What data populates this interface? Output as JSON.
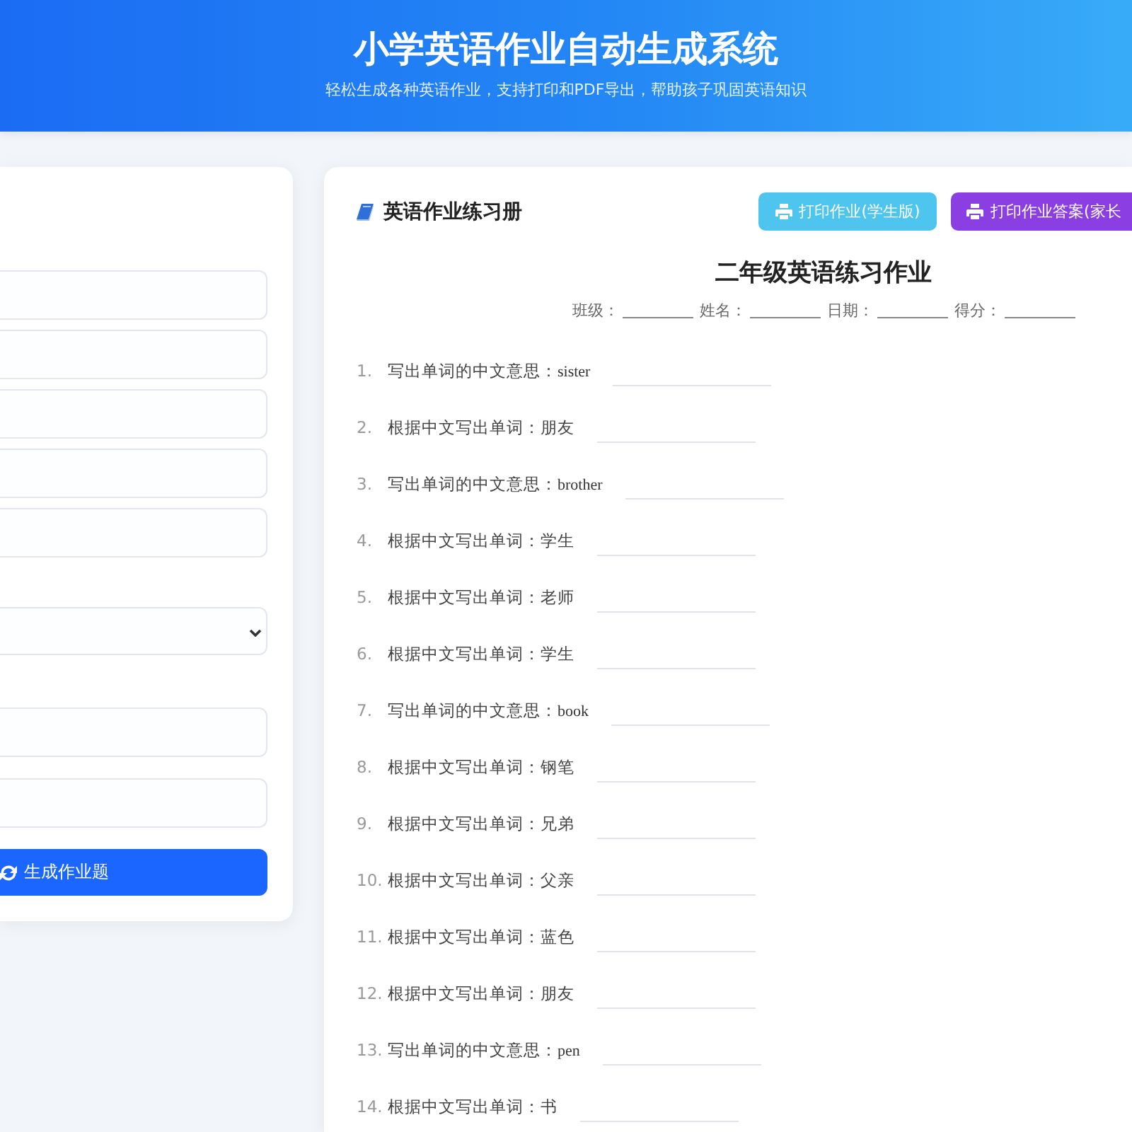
{
  "header": {
    "title": "小学英语作业自动生成系统",
    "subtitle": "轻松生成各种英语作业，支持打印和PDF导出，帮助孩子巩固英语知识"
  },
  "settings_panel": {
    "field_groups": [
      {
        "fields": [
          {
            "kind": "input"
          },
          {
            "kind": "input"
          },
          {
            "kind": "input"
          },
          {
            "kind": "input"
          },
          {
            "kind": "input"
          }
        ]
      },
      {
        "fields": [
          {
            "kind": "select"
          }
        ]
      },
      {
        "fields": [
          {
            "kind": "input"
          },
          {
            "kind": "input"
          }
        ]
      }
    ],
    "generate_button": "生成作业题"
  },
  "workbook": {
    "title": "英语作业练习册",
    "buttons": [
      {
        "label": "打印作业(学生版)",
        "kind": "student"
      },
      {
        "label": "打印作业答案(家长",
        "kind": "answers"
      }
    ],
    "sheet_title": "二年级英语练习作业",
    "info_fields": [
      {
        "label": "班级："
      },
      {
        "label": "姓名："
      },
      {
        "label": "日期："
      },
      {
        "label": "得分："
      }
    ],
    "questions": [
      {
        "number": "1.",
        "prompt": "写出单词的中文意思：",
        "word": "sister",
        "kind": "meaning"
      },
      {
        "number": "2.",
        "prompt": "根据中文写出单词：",
        "word": "朋友",
        "kind": "spelling"
      },
      {
        "number": "3.",
        "prompt": "写出单词的中文意思：",
        "word": "brother",
        "kind": "meaning"
      },
      {
        "number": "4.",
        "prompt": "根据中文写出单词：",
        "word": "学生",
        "kind": "spelling"
      },
      {
        "number": "5.",
        "prompt": "根据中文写出单词：",
        "word": "老师",
        "kind": "spelling"
      },
      {
        "number": "6.",
        "prompt": "根据中文写出单词：",
        "word": "学生",
        "kind": "spelling"
      },
      {
        "number": "7.",
        "prompt": "写出单词的中文意思：",
        "word": "book",
        "kind": "meaning"
      },
      {
        "number": "8.",
        "prompt": "根据中文写出单词：",
        "word": "钢笔",
        "kind": "spelling"
      },
      {
        "number": "9.",
        "prompt": "根据中文写出单词：",
        "word": "兄弟",
        "kind": "spelling"
      },
      {
        "number": "10.",
        "prompt": "根据中文写出单词：",
        "word": "父亲",
        "kind": "spelling"
      },
      {
        "number": "11.",
        "prompt": "根据中文写出单词：",
        "word": "蓝色",
        "kind": "spelling"
      },
      {
        "number": "12.",
        "prompt": "根据中文写出单词：",
        "word": "朋友",
        "kind": "spelling"
      },
      {
        "number": "13.",
        "prompt": "写出单词的中文意思：",
        "word": "pen",
        "kind": "meaning"
      },
      {
        "number": "14.",
        "prompt": "根据中文写出单词：",
        "word": "书",
        "kind": "spelling"
      }
    ]
  }
}
